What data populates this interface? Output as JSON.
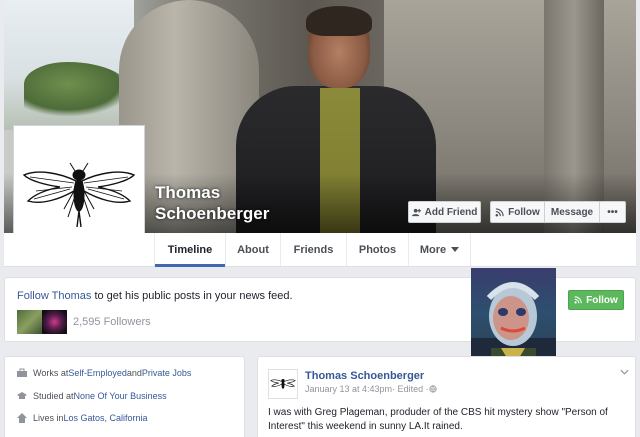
{
  "profile": {
    "name": "Thomas Schoenberger"
  },
  "cover_actions": {
    "add_friend": "Add Friend",
    "follow": "Follow",
    "message": "Message",
    "more_dots": "•••"
  },
  "nav": {
    "tabs": [
      {
        "label": "Timeline"
      },
      {
        "label": "About"
      },
      {
        "label": "Friends"
      },
      {
        "label": "Photos"
      },
      {
        "label": "More"
      }
    ]
  },
  "follow_box": {
    "prefix": "Follow Thomas",
    "suffix": " to get his public posts in your news feed.",
    "followers": "2,595 Followers",
    "button": "Follow"
  },
  "about": {
    "work_prefix": "Works at ",
    "work_link1": "Self-Employed",
    "work_mid": " and ",
    "work_link2": "Private Jobs",
    "study_prefix": "Studied at ",
    "study_link": "None Of Your Business",
    "lives_prefix": "Lives in ",
    "lives_link": "Los Gatos, California"
  },
  "post": {
    "author": "Thomas Schoenberger",
    "date": "January 13 at 4:43pm",
    "edited": " · Edited · ",
    "text": "I was with Greg Plageman, produder of the CBS hit mystery show \"Person of Interest\" this weekend in sunny LA.It rained."
  },
  "colors": {
    "link": "#365899",
    "accent": "#4267b2",
    "follow_green": "#5cb85c"
  }
}
